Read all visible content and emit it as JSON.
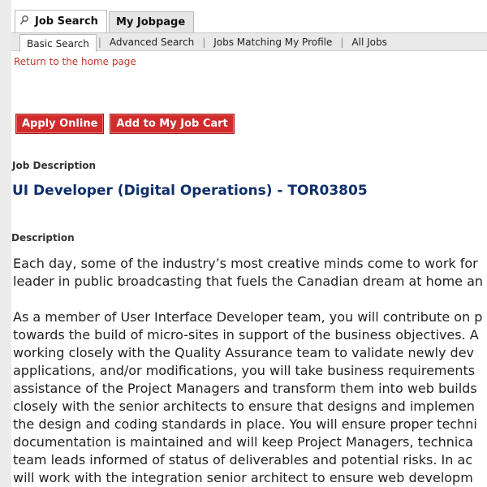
{
  "tabs": {
    "job_search": "Job Search",
    "my_jobpage": "My Jobpage"
  },
  "subnav": {
    "basic_search": "Basic Search",
    "advanced_search": "Advanced Search",
    "jobs_matching": "Jobs Matching My Profile",
    "all_jobs": "All Jobs",
    "separator": "|"
  },
  "home_link": "Return to the home page",
  "actions": {
    "apply": "Apply Online",
    "add_cart": "Add to My Job Cart"
  },
  "job": {
    "section_label": "Job Description",
    "title": "UI Developer (Digital Operations) - TOR03805",
    "description_label": "Description",
    "paragraph1": [
      "Each day, some of the industry’s most creative minds come to work for",
      "leader in public broadcasting that fuels the Canadian dream at home an"
    ],
    "paragraph2": [
      "As a member of User Interface Developer team, you will contribute on p",
      "towards the build of micro-sites in support of the business objectives. A",
      "working closely with the Quality Assurance team to validate newly dev",
      "applications, and/or modifications, you will take business requirements",
      "assistance of the Project Managers and transform them into web builds",
      "closely with the senior architects to ensure that designs and implemen",
      "the design and coding standards in place. You will ensure proper techni",
      "documentation is maintained and will keep Project Managers, technica",
      "team leads informed of status of deliverables and potential risks.  In ac",
      "will work with the integration senior architect to ensure web developm"
    ]
  },
  "colors": {
    "button_red": "#d22b2b",
    "title_blue": "#0f2f6b",
    "link_red": "#c0392b"
  }
}
